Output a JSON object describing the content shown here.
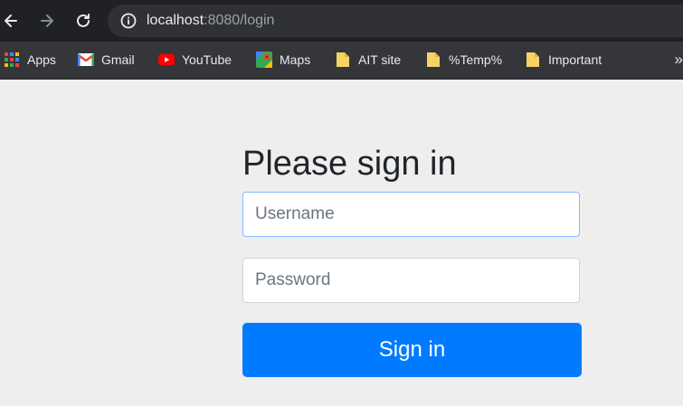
{
  "browser": {
    "url_host": "localhost",
    "url_rest": ":8080/login",
    "bookmarks": [
      {
        "label": "Apps",
        "icon": "apps-grid-icon"
      },
      {
        "label": "Gmail",
        "icon": "gmail-icon"
      },
      {
        "label": "YouTube",
        "icon": "youtube-icon"
      },
      {
        "label": "Maps",
        "icon": "maps-icon"
      },
      {
        "label": "AIT site",
        "icon": "folder-icon"
      },
      {
        "label": "%Temp%",
        "icon": "folder-icon"
      },
      {
        "label": "Important",
        "icon": "folder-icon"
      }
    ],
    "more_label": "»"
  },
  "login": {
    "heading": "Please sign in",
    "username_placeholder": "Username",
    "password_placeholder": "Password",
    "submit_label": "Sign in"
  },
  "colors": {
    "primary": "#007bff",
    "page_bg": "#eeeeee",
    "chrome_bg": "#202124"
  }
}
